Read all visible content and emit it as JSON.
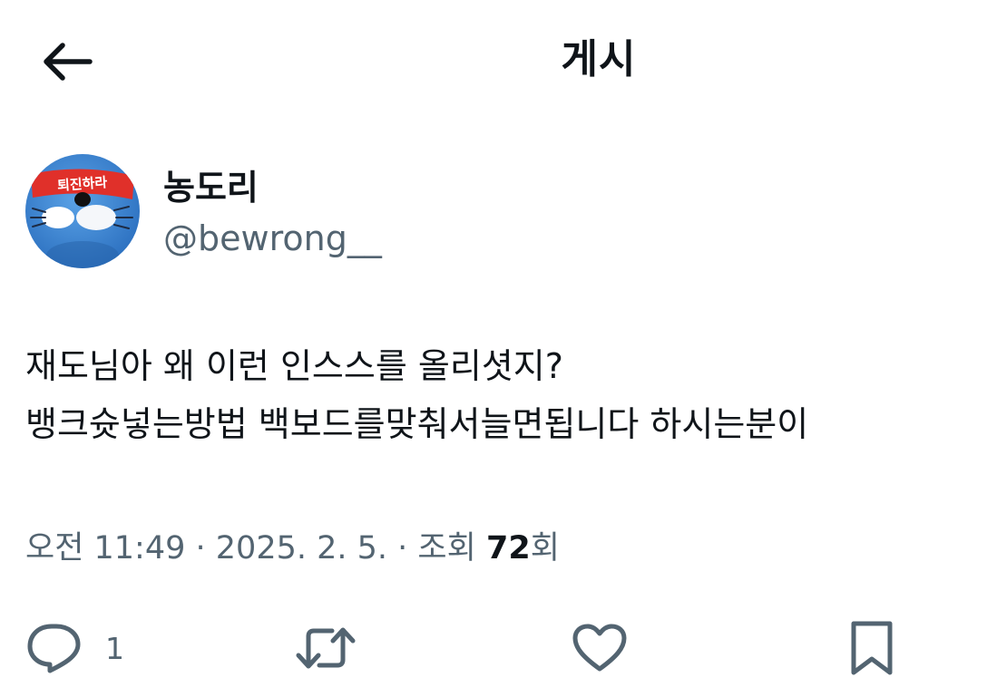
{
  "header": {
    "title": "게시",
    "back_icon": "arrow-left-icon"
  },
  "author": {
    "display_name": "농도리",
    "handle": "@bewrong__",
    "avatar_headband_text": "퇴진하라"
  },
  "post": {
    "lines": [
      "재도님아 왜 이런 인스스를 올리셧지?",
      "뱅크슛넣는방법 백보드를맞춰서늘면됩니다 하시는분이"
    ]
  },
  "meta": {
    "time": "오전 11:49",
    "separator": " · ",
    "date": "2025. 2. 5.",
    "views_label": "조회",
    "views_count": "72",
    "views_suffix": "회"
  },
  "actions": {
    "reply_icon": "reply-icon",
    "reply_count": "1",
    "repost_icon": "repost-icon",
    "like_icon": "heart-icon",
    "bookmark_icon": "bookmark-icon"
  },
  "colors": {
    "text_primary": "#0f1419",
    "text_secondary": "#536471",
    "background": "#ffffff",
    "avatar_blue": "#3d86d6",
    "avatar_headband": "#e0302a"
  }
}
